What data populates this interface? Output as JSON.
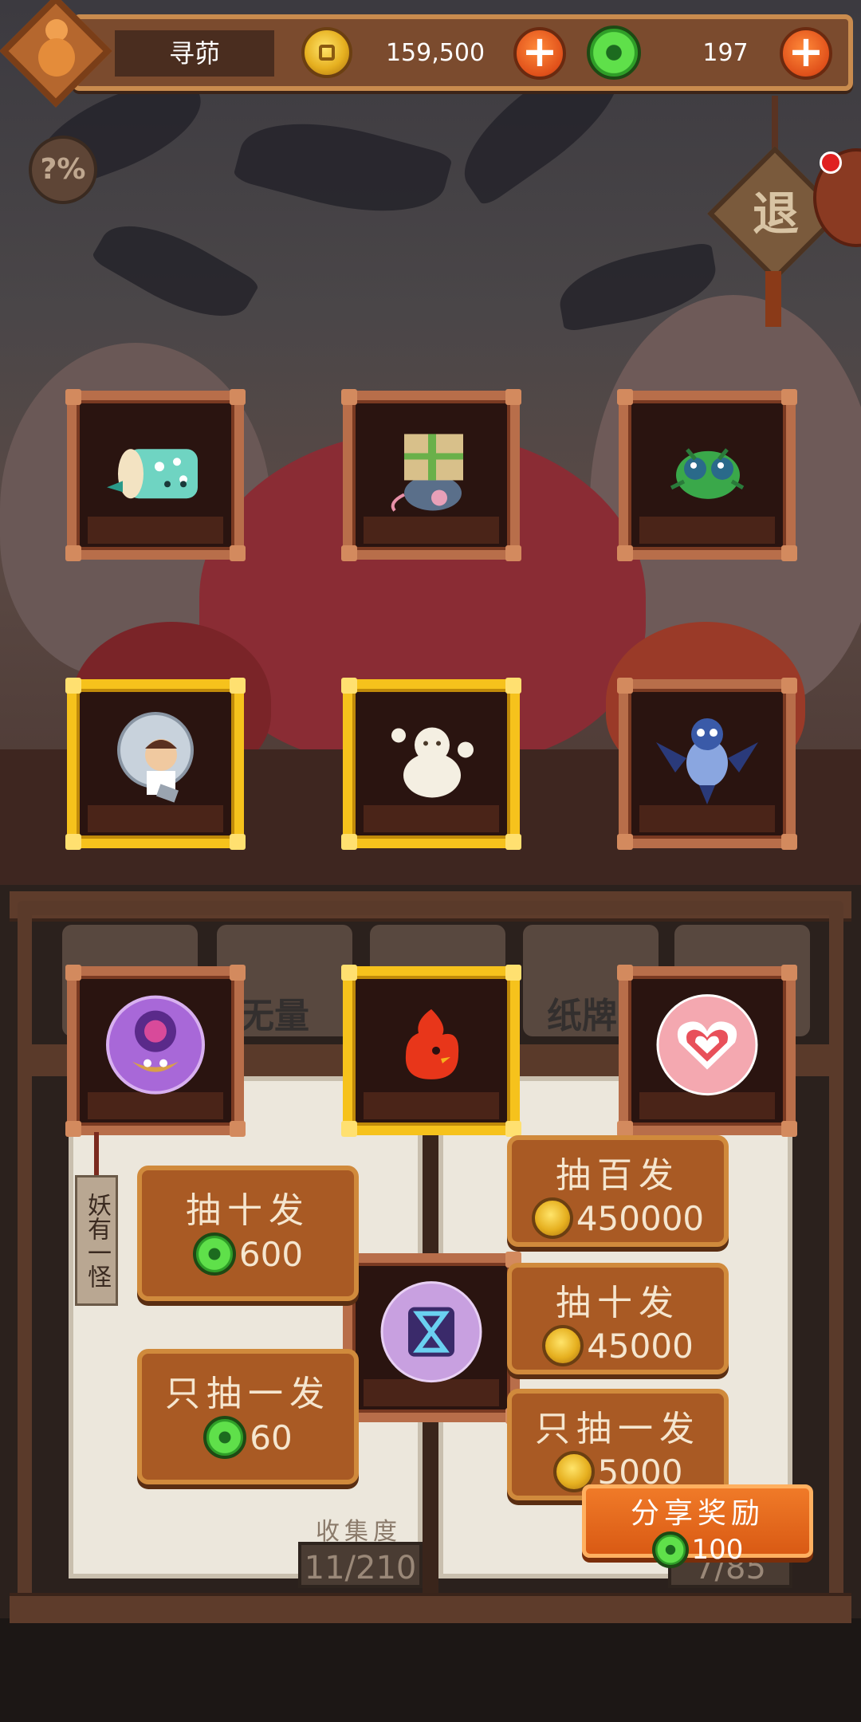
{
  "player": {
    "name": "寻茆",
    "coins": "159,500",
    "jade": "197"
  },
  "ui": {
    "help_icon_text": "?%",
    "exit_label": "退"
  },
  "shelf_tabs": {
    "labels": [
      "无量",
      "纸牌"
    ]
  },
  "cards": [
    {
      "id": "scroll-creature",
      "highlight": false
    },
    {
      "id": "box-rat",
      "highlight": false
    },
    {
      "id": "green-beetle",
      "highlight": false
    },
    {
      "id": "astronaut-kid",
      "highlight": true
    },
    {
      "id": "steam-dumpling",
      "highlight": true
    },
    {
      "id": "blue-bird",
      "highlight": false
    },
    {
      "id": "purple-orb-owl",
      "highlight": false
    },
    {
      "id": "fire-chick",
      "highlight": true
    },
    {
      "id": "pink-heart-orb",
      "highlight": false
    },
    {
      "id": "hourglass-orb",
      "highlight": false
    }
  ],
  "left_panel": {
    "tag": "妖有一怪",
    "ten_draw": {
      "label": "抽十发",
      "cost": "600"
    },
    "single_draw": {
      "label": "只抽一发",
      "cost": "60"
    },
    "collection_label": "收集度",
    "collection_value": "11/210"
  },
  "right_panel": {
    "hundred_draw": {
      "label": "抽百发",
      "cost": "450000"
    },
    "ten_draw": {
      "label": "抽十发",
      "cost": "45000"
    },
    "single_draw": {
      "label": "只抽一发",
      "cost": "5000"
    },
    "collection_value": "7/85"
  },
  "share": {
    "label": "分享奖励",
    "reward": "100"
  },
  "colors": {
    "card_frame": "#b86e4a",
    "card_frame_highlight": "#f6c21c",
    "button_bg": "#a95a24",
    "share_bg": "#e8661e"
  }
}
